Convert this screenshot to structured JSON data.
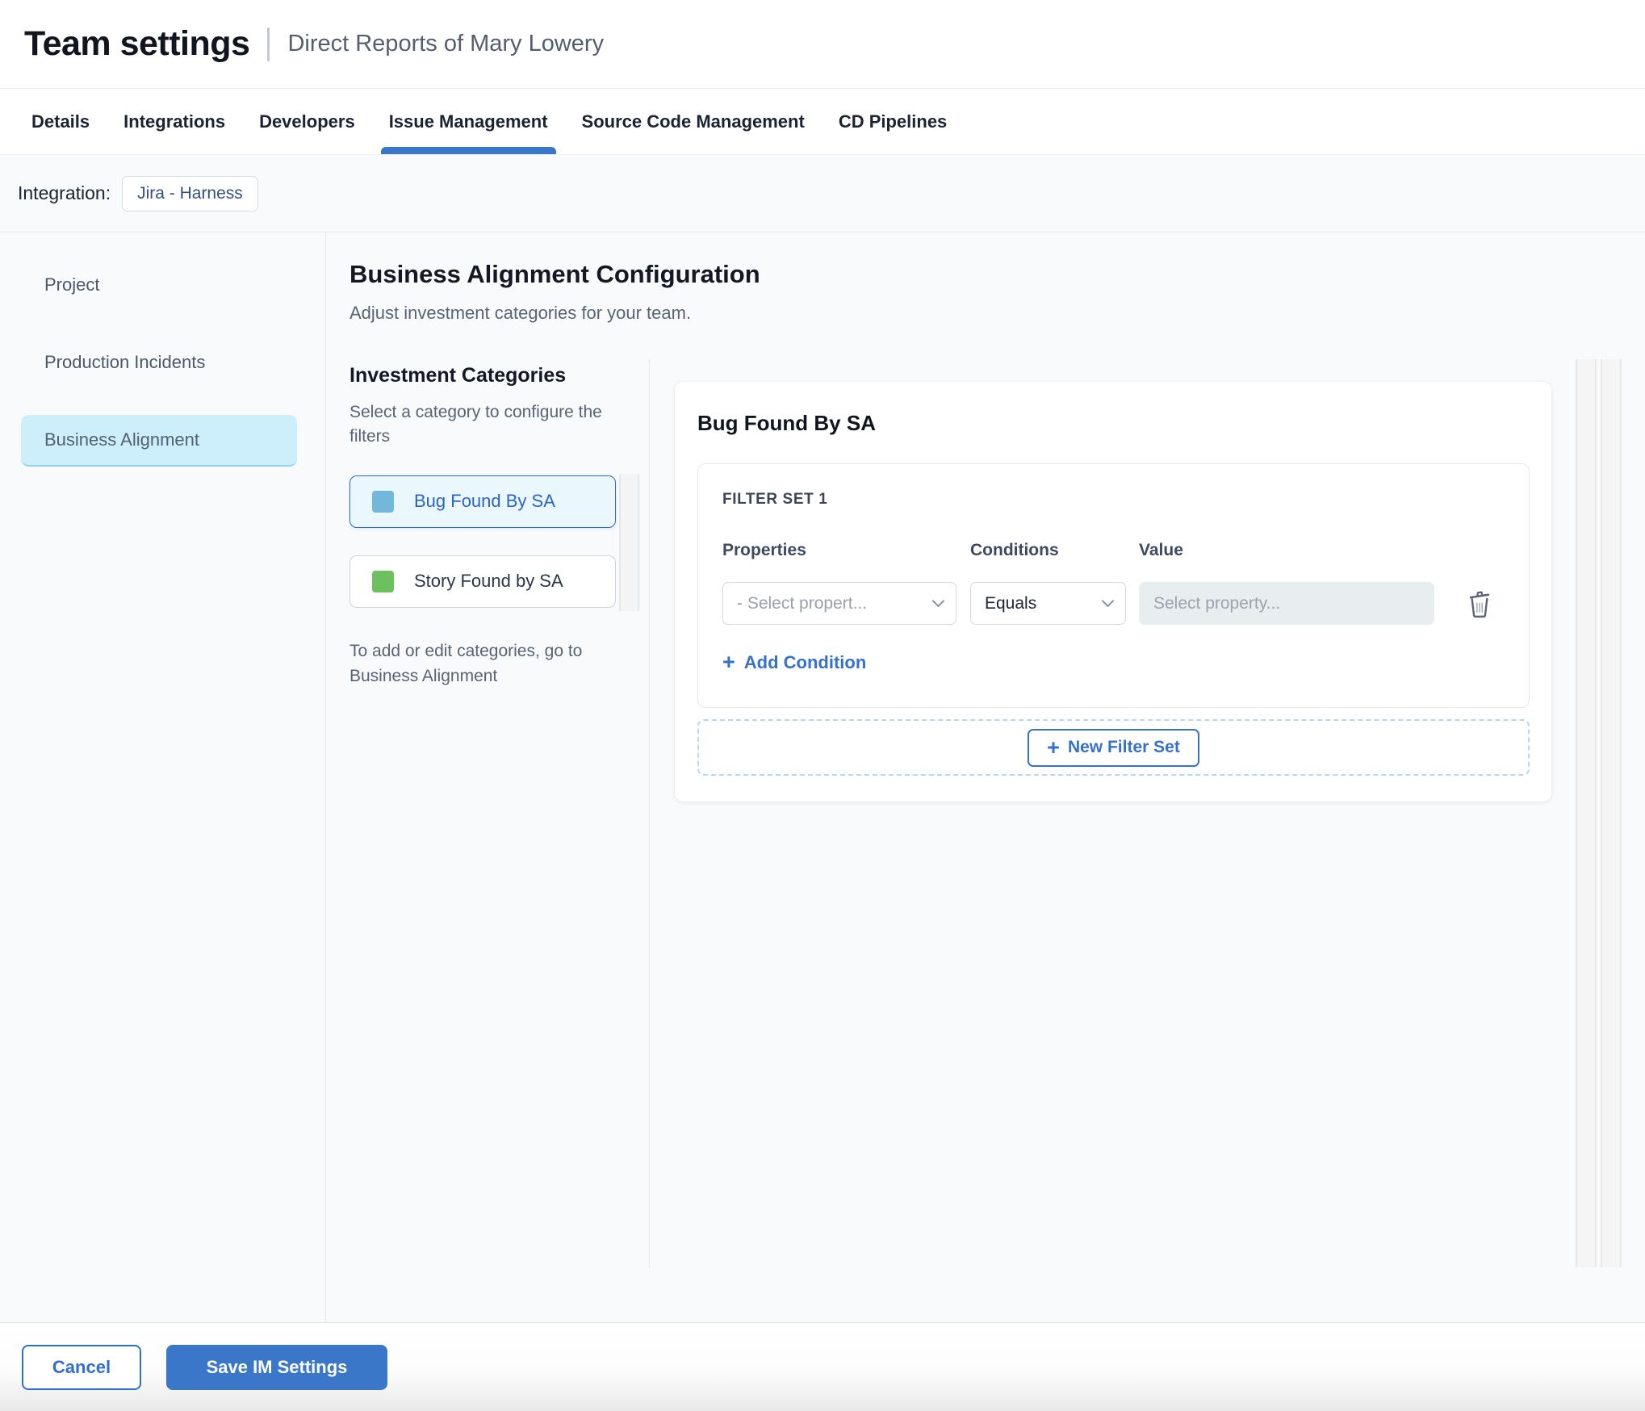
{
  "header": {
    "title": "Team settings",
    "subtitle": "Direct Reports of Mary Lowery"
  },
  "tabs": {
    "items": [
      {
        "label": "Details"
      },
      {
        "label": "Integrations"
      },
      {
        "label": "Developers"
      },
      {
        "label": "Issue Management"
      },
      {
        "label": "Source Code Management"
      },
      {
        "label": "CD Pipelines"
      }
    ],
    "active": "Issue Management"
  },
  "integration": {
    "label": "Integration:",
    "value": "Jira - Harness"
  },
  "sidebar": {
    "items": [
      {
        "label": "Project",
        "active": false
      },
      {
        "label": "Production Incidents",
        "active": false
      },
      {
        "label": "Business Alignment",
        "active": true
      }
    ]
  },
  "main": {
    "title": "Business Alignment Configuration",
    "subtitle": "Adjust investment categories for your team.",
    "categories": {
      "title": "Investment Categories",
      "hint": "Select a category to configure the filters",
      "items": [
        {
          "label": "Bug Found By SA",
          "color": "#72b8dd",
          "selected": true
        },
        {
          "label": "Story Found by SA",
          "color": "#6cc05e",
          "selected": false
        }
      ],
      "note": "To add or edit categories, go to Business Alignment"
    },
    "panel": {
      "title": "Bug Found By SA",
      "filter_set": {
        "label": "FILTER SET 1",
        "columns": [
          "Properties",
          "Conditions",
          "Value"
        ],
        "properties_placeholder": "- Select propert...",
        "conditions_value": "Equals",
        "value_placeholder": "Select property...",
        "add_condition_label": "Add Condition"
      },
      "new_filter_set_label": "New Filter Set"
    }
  },
  "footer": {
    "cancel_label": "Cancel",
    "save_label": "Save IM Settings"
  },
  "icons": {
    "plus": "+"
  },
  "colors": {
    "accent_blue": "#3671cd",
    "primary_button": "#3b77c9",
    "tab_underline": "#3b77c9",
    "sidebar_active_bg": "#cdeefb",
    "selected_category_bg": "#eaf7fd",
    "category_bug_swatch": "#72b8dd",
    "category_story_swatch": "#6cc05e"
  }
}
